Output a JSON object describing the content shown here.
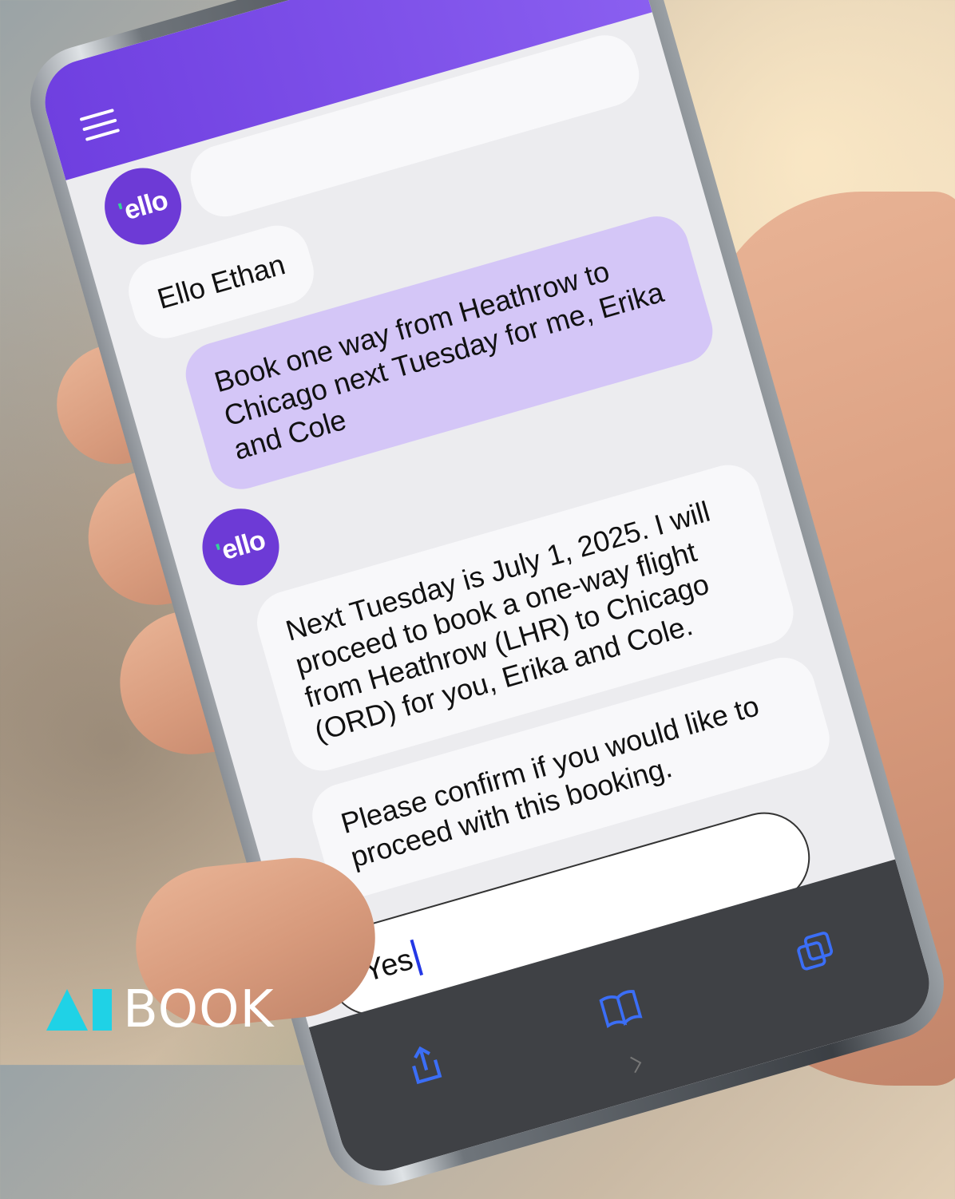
{
  "app": {
    "avatar_label": "ello",
    "accent": "#7a4ce6",
    "user_bubble_color": "#d4c6f7"
  },
  "messages": [
    {
      "from": "bot",
      "text": "Ello Ethan"
    },
    {
      "from": "user",
      "text": "Book one way from Heathrow to Chicago next Tuesday for me, Erika and Cole"
    },
    {
      "from": "bot",
      "text": "Next Tuesday is July 1, 2025. I will proceed to book a one-way flight from Heathrow (LHR) to Chicago (ORD) for you, Erika and Cole."
    },
    {
      "from": "bot",
      "text": "Please confirm if you would like to proceed with this booking."
    }
  ],
  "input": {
    "value": "Yes"
  },
  "toolbar": {
    "icons": [
      "share-icon",
      "bookmarks-icon",
      "tabs-icon"
    ]
  },
  "brand": {
    "text": "BOOK",
    "logo_color": "#1fd2e6"
  }
}
